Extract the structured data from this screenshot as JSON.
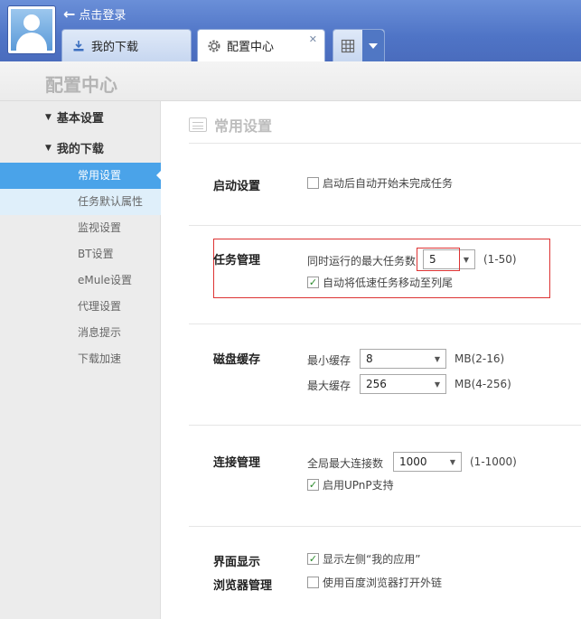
{
  "header": {
    "login_link": "点击登录",
    "tabs": [
      {
        "label": "我的下载"
      },
      {
        "label": "配置中心",
        "close": "✕"
      }
    ]
  },
  "page": {
    "title": "配置中心"
  },
  "sidebar": {
    "groups": [
      "基本设置",
      "我的下载"
    ],
    "items": [
      "常用设置",
      "任务默认属性",
      "监视设置",
      "BT设置",
      "eMule设置",
      "代理设置",
      "消息提示",
      "下载加速"
    ]
  },
  "main": {
    "section_title": "常用设置",
    "startup": {
      "label": "启动设置",
      "auto_start": {
        "text": "启动后自动开始未完成任务",
        "checked": false
      }
    },
    "task": {
      "label": "任务管理",
      "max_tasks_label": "同时运行的最大任务数",
      "max_tasks_value": "5",
      "max_tasks_range": "(1-50)",
      "move_slow": {
        "text": "自动将低速任务移动至列尾",
        "checked": true
      }
    },
    "disk": {
      "label": "磁盘缓存",
      "min_label": "最小缓存",
      "min_value": "8",
      "min_unit": "MB(2-16)",
      "max_label": "最大缓存",
      "max_value": "256",
      "max_unit": "MB(4-256)"
    },
    "conn": {
      "label": "连接管理",
      "max_conn_label": "全局最大连接数",
      "max_conn_value": "1000",
      "max_conn_range": "(1-1000)",
      "upnp": {
        "text": "启用UPnP支持",
        "checked": true
      }
    },
    "ui": {
      "label": "界面显示",
      "show_app": {
        "text": "显示左侧“我的应用”",
        "checked": true
      }
    },
    "browser": {
      "label": "浏览器管理",
      "use_baidu": {
        "text": "使用百度浏览器打开外链",
        "checked": false
      }
    }
  }
}
